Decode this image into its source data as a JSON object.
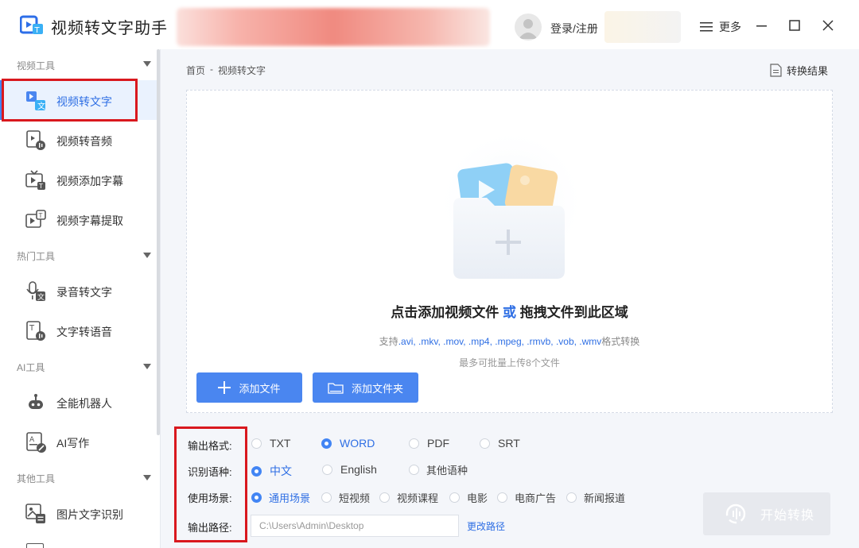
{
  "app": {
    "title": "视频转文字助手"
  },
  "header": {
    "login_label": "登录/注册",
    "more_label": "更多"
  },
  "sidebar": {
    "groups": [
      {
        "label": "视频工具",
        "items": [
          "视频转文字",
          "视频转音频",
          "视频添加字幕",
          "视频字幕提取"
        ]
      },
      {
        "label": "热门工具",
        "items": [
          "录音转文字",
          "文字转语音"
        ]
      },
      {
        "label": "AI工具",
        "items": [
          "全能机器人",
          "AI写作"
        ]
      },
      {
        "label": "其他工具",
        "items": [
          "图片文字识别"
        ]
      }
    ],
    "active_item": "视频转文字"
  },
  "breadcrumb": {
    "home": "首页",
    "separator": "-",
    "current": "视频转文字"
  },
  "result_link": "转换结果",
  "dropzone": {
    "title_prefix": "点击添加视频文件",
    "title_or": "或",
    "title_suffix": "拖拽文件到此区域",
    "support_prefix": "支持",
    "support_formats": ".avi, .mkv, .mov, .mp4, .mpeg, .rmvb, .vob, .wmv",
    "support_suffix": "格式转换",
    "limit_text": "最多可批量上传8个文件",
    "add_file_label": "添加文件",
    "add_folder_label": "添加文件夹"
  },
  "options": {
    "format": {
      "label": "输出格式:",
      "choices": [
        "TXT",
        "WORD",
        "PDF",
        "SRT"
      ],
      "selected": "WORD"
    },
    "language": {
      "label": "识别语种:",
      "choices": [
        "中文",
        "English",
        "其他语种"
      ],
      "selected": "中文"
    },
    "scene": {
      "label": "使用场景:",
      "choices": [
        "通用场景",
        "短视频",
        "视频课程",
        "电影",
        "电商广告",
        "新闻报道"
      ],
      "selected": "通用场景"
    },
    "path": {
      "label": "输出路径:",
      "value": "C:\\Users\\Admin\\Desktop",
      "change_label": "更改路径"
    }
  },
  "start_button": {
    "label": "开始转换",
    "enabled": false
  },
  "colors": {
    "accent": "#4285f4",
    "highlight": "#d9181e",
    "button": "#4a86f0"
  }
}
